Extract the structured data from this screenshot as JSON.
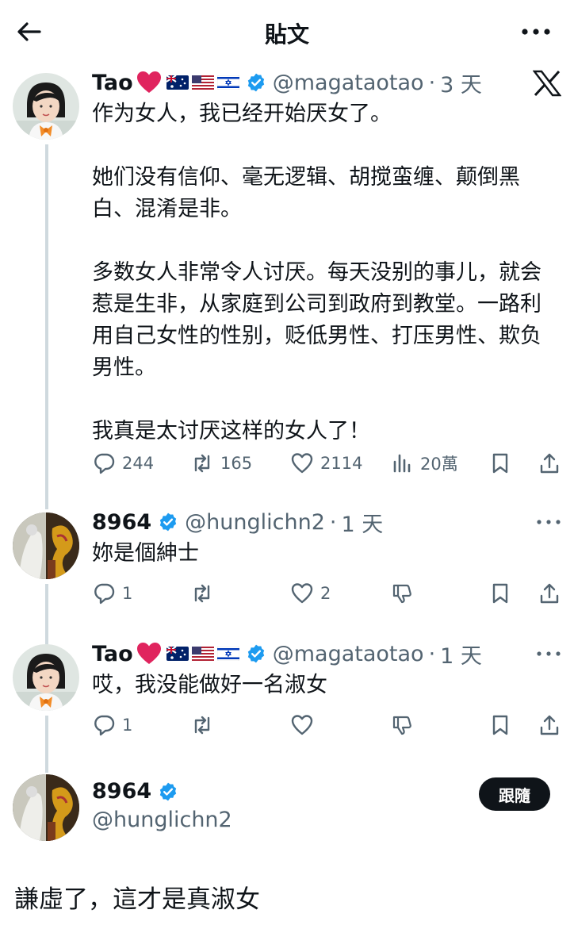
{
  "header": {
    "title": "貼文",
    "back_icon": "arrow-left-icon",
    "more_icon": "more-horizontal-icon"
  },
  "colors": {
    "text": "#0f1419",
    "muted": "#536471",
    "verified": "#1d9bf0",
    "line": "#cfd9de"
  },
  "posts": [
    {
      "name": "Tao",
      "handle": "@magataotao",
      "time": "3 天",
      "text": "作为女人，我已经开始厌女了。\n\n她们没有信仰、毫无逻辑、胡搅蛮缠、颠倒黑白、混淆是非。\n\n多数女人非常令人讨厌。每天没别的事儿，就会惹是生非，从家庭到公司到政府到教堂。一路利用自己女性的性别，贬低男性、打压男性、欺负男性。\n\n我真是太讨厌这样的女人了！",
      "replies": "244",
      "reposts": "165",
      "likes": "2114",
      "views": "20萬"
    },
    {
      "name": "8964",
      "handle": "@hunglichn2",
      "time": "1 天",
      "text": "妳是個紳士",
      "replies": "1",
      "likes": "2"
    },
    {
      "name": "Tao",
      "handle": "@magataotao",
      "time": "1 天",
      "text": "哎，我没能做好一名淑女",
      "replies": "1"
    }
  ],
  "focus": {
    "name": "8964",
    "handle": "@hunglichn2",
    "follow_label": "跟隨",
    "text": "謙虛了，這才是真淑女"
  }
}
